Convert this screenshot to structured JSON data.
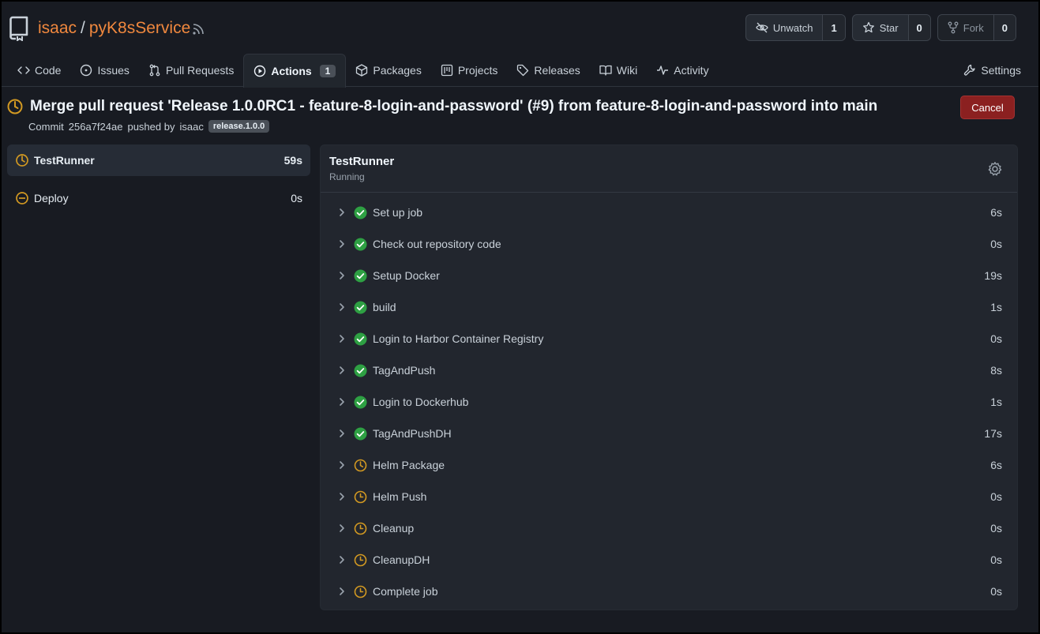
{
  "repo": {
    "owner": "isaac",
    "separator": "/",
    "name": "pyK8sService"
  },
  "header_buttons": {
    "unwatch": {
      "label": "Unwatch",
      "count": "1"
    },
    "star": {
      "label": "Star",
      "count": "0"
    },
    "fork": {
      "label": "Fork",
      "count": "0"
    }
  },
  "tabs": [
    {
      "label": "Code",
      "icon": "code-icon"
    },
    {
      "label": "Issues",
      "icon": "issue-icon"
    },
    {
      "label": "Pull Requests",
      "icon": "pull-request-icon"
    },
    {
      "label": "Actions",
      "icon": "play-icon",
      "badge": "1",
      "active": true
    },
    {
      "label": "Packages",
      "icon": "package-icon"
    },
    {
      "label": "Projects",
      "icon": "project-icon"
    },
    {
      "label": "Releases",
      "icon": "tag-icon"
    },
    {
      "label": "Wiki",
      "icon": "book-icon"
    },
    {
      "label": "Activity",
      "icon": "pulse-icon"
    }
  ],
  "settings_tab": {
    "label": "Settings",
    "icon": "tool-icon"
  },
  "run": {
    "title": "Merge pull request 'Release 1.0.0RC1 - feature-8-login-and-password' (#9) from feature-8-login-and-password into main",
    "commit_prefix": "Commit",
    "commit_sha": "256a7f24ae",
    "pushed_by": "pushed by",
    "user": "isaac",
    "tag": "release.1.0.0",
    "cancel_label": "Cancel"
  },
  "jobs": [
    {
      "name": "TestRunner",
      "duration": "59s",
      "status": "running",
      "active": true
    },
    {
      "name": "Deploy",
      "duration": "0s",
      "status": "blocked"
    }
  ],
  "panel": {
    "job_name": "TestRunner",
    "status": "Running"
  },
  "steps": [
    {
      "name": "Set up job",
      "duration": "6s",
      "status": "success"
    },
    {
      "name": "Check out repository code",
      "duration": "0s",
      "status": "success"
    },
    {
      "name": "Setup Docker",
      "duration": "19s",
      "status": "success"
    },
    {
      "name": "build",
      "duration": "1s",
      "status": "success"
    },
    {
      "name": "Login to Harbor Container Registry",
      "duration": "0s",
      "status": "success"
    },
    {
      "name": "TagAndPush",
      "duration": "8s",
      "status": "success"
    },
    {
      "name": "Login to Dockerhub",
      "duration": "1s",
      "status": "success"
    },
    {
      "name": "TagAndPushDH",
      "duration": "17s",
      "status": "success"
    },
    {
      "name": "Helm Package",
      "duration": "6s",
      "status": "running"
    },
    {
      "name": "Helm Push",
      "duration": "0s",
      "status": "queued"
    },
    {
      "name": "Cleanup",
      "duration": "0s",
      "status": "queued"
    },
    {
      "name": "CleanupDH",
      "duration": "0s",
      "status": "queued"
    },
    {
      "name": "Complete job",
      "duration": "0s",
      "status": "queued"
    }
  ],
  "colors": {
    "accent_orange": "#f0883e",
    "success": "#2ea043",
    "pending": "#d29922",
    "cancel": "#8b2020"
  }
}
